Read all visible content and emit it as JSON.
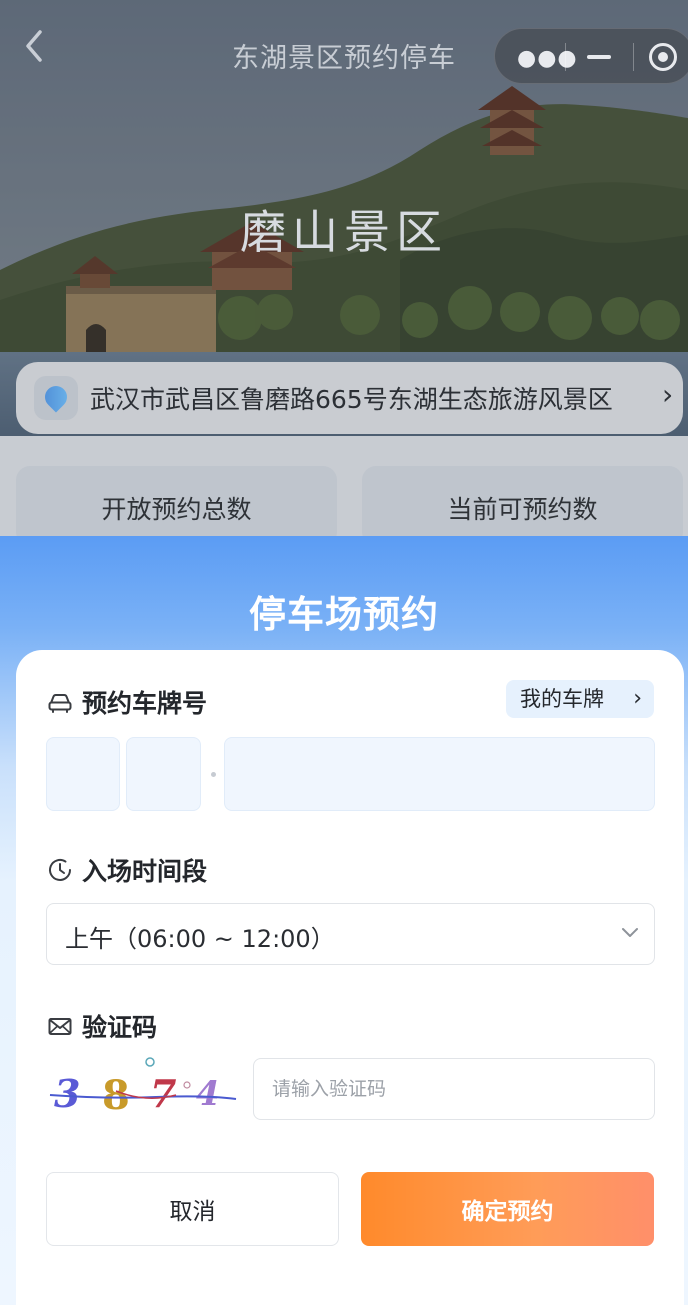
{
  "nav": {
    "title": "东湖景区预约停车",
    "back_icon": "chevron-left-icon",
    "more_icon": "more-dots-icon",
    "minimize_icon": "minus-icon",
    "close_icon": "target-circle-icon"
  },
  "hero": {
    "scenic_name": "磨山景区"
  },
  "address": {
    "icon": "location-icon",
    "text": "武汉市武昌区鲁磨路665号东湖生态旅游风景区"
  },
  "stats": {
    "total_label": "开放预约总数",
    "total_value": "",
    "available_label": "当前可预约数",
    "available_value": ""
  },
  "sheet": {
    "title": "停车场预约",
    "plate_section": {
      "icon": "car-icon",
      "label": "预约车牌号",
      "my_plate_label": "我的车牌"
    },
    "time_section": {
      "icon": "clock-icon",
      "label": "入场时间段",
      "selected_value": "上午（06:00 ~ 12:00）"
    },
    "captcha_section": {
      "icon": "mail-icon",
      "label": "验证码",
      "captcha_text": "3874",
      "input_placeholder": "请输入验证码",
      "input_value": ""
    },
    "buttons": {
      "cancel_label": "取消",
      "confirm_label": "确定预约"
    }
  }
}
